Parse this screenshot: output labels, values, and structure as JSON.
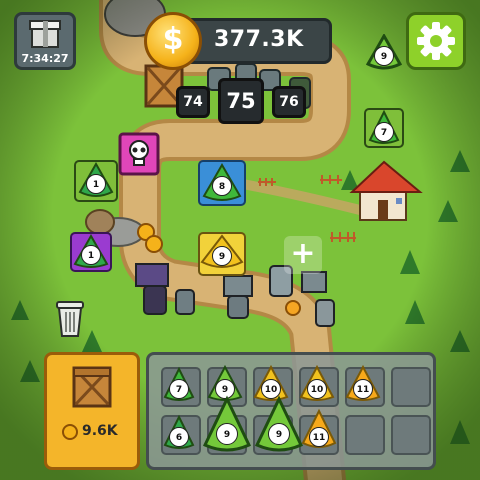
{
  "hud": {
    "gift_timer": "7:34:27",
    "coins": "377.3K",
    "coin_symbol": "$",
    "wave_prev": "74",
    "wave_current": "75",
    "wave_next": "76"
  },
  "shop": {
    "crate_price": "9.6K"
  },
  "field_towers": [
    {
      "kind": "green",
      "level": "9"
    },
    {
      "kind": "green",
      "level": "7"
    },
    {
      "kind": "green",
      "level": "1"
    },
    {
      "kind": "blue",
      "level": "8"
    },
    {
      "kind": "green",
      "level": "1"
    },
    {
      "kind": "gold",
      "level": "9"
    }
  ],
  "merge_grid": [
    {
      "kind": "green",
      "level": "7"
    },
    {
      "kind": "green",
      "level": "9"
    },
    {
      "kind": "gold",
      "level": "10"
    },
    {
      "kind": "gold",
      "level": "10"
    },
    {
      "kind": "gold",
      "level": "11"
    },
    {
      "kind": "green",
      "level": "6"
    },
    {
      "kind": "green",
      "level": "9"
    },
    {
      "kind": "green",
      "level": "9"
    },
    {
      "kind": "gold",
      "level": "11"
    }
  ],
  "colors": {
    "grass": "#7cc23a",
    "path": "#c9a466",
    "gold": "#f4b52a",
    "accent_green": "#8ed12a"
  }
}
